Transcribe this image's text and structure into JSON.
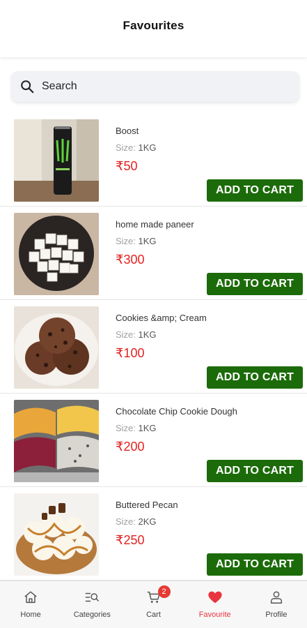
{
  "header": {
    "title": "Favourites"
  },
  "search": {
    "placeholder": "Search"
  },
  "products": [
    {
      "name": "Boost",
      "size_label": "Size:",
      "size": "1KG",
      "price": "₹50",
      "cart_label": "ADD TO CART",
      "image": "energy-drink-can"
    },
    {
      "name": "home made paneer",
      "size_label": "Size:",
      "size": "1KG",
      "price": "₹300",
      "cart_label": "ADD TO CART",
      "image": "paneer-cubes"
    },
    {
      "name": "Cookies &amp; Cream",
      "size_label": "Size:",
      "size": "1KG",
      "price": "₹100",
      "cart_label": "ADD TO CART",
      "image": "chocolate-ice-cream-bowl"
    },
    {
      "name": "Chocolate Chip Cookie Dough",
      "size_label": "Size:",
      "size": "1KG",
      "price": "₹200",
      "cart_label": "ADD TO CART",
      "image": "gelato-trays"
    },
    {
      "name": "Buttered Pecan",
      "size_label": "Size:",
      "size": "2KG",
      "price": "₹250",
      "cart_label": "ADD TO CART",
      "image": "ice-cream-cake"
    }
  ],
  "tabbar": {
    "items": [
      {
        "label": "Home",
        "icon": "home-icon"
      },
      {
        "label": "Categories",
        "icon": "categories-icon"
      },
      {
        "label": "Cart",
        "icon": "cart-icon",
        "badge": "2"
      },
      {
        "label": "Favourite",
        "icon": "heart-icon",
        "active": true
      },
      {
        "label": "Profile",
        "icon": "profile-icon"
      }
    ]
  },
  "colors": {
    "accent_green": "#1c6b0a",
    "price_red": "#e32222",
    "active_tab": "#e8343f"
  }
}
